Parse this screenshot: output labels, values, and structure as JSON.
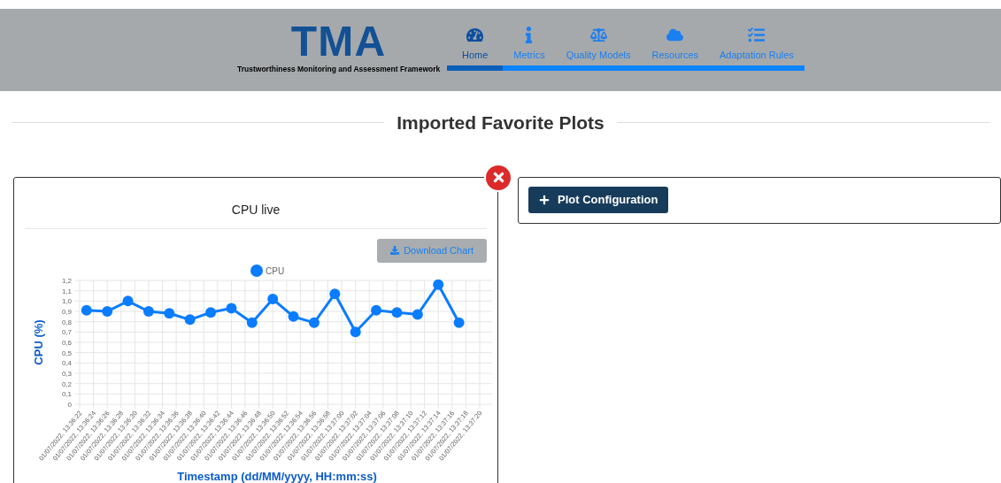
{
  "header": {
    "logo": "TMA",
    "subtitle": "Trustworthiness Monitoring and Assessment Framework"
  },
  "nav": [
    {
      "label": "Home",
      "kind": "gauge",
      "selected": true
    },
    {
      "label": "Metrics",
      "kind": "info",
      "selected": false
    },
    {
      "label": "Quality Models",
      "kind": "scale",
      "selected": false
    },
    {
      "label": "Resources",
      "kind": "cloud",
      "selected": false
    },
    {
      "label": "Adaptation Rules",
      "kind": "tasks",
      "selected": false
    }
  ],
  "page_title": "Imported Favorite Plots",
  "plot_card": {
    "title": "CPU live",
    "download_button": "Download Chart",
    "chart_data": {
      "type": "line",
      "xlabel": "Timestamp (dd/MM/yyyy, HH:mm:ss)",
      "ylabel": "CPU (%)",
      "categories": [
        "01/07/2022, 13:36:22",
        null,
        "01/07/2022, 13:36:24",
        null,
        "01/07/2022, 13:36:26",
        null,
        "01/07/2022, 13:36:28",
        null,
        "01/07/2022, 13:36:30",
        null,
        "01/07/2022, 13:36:32",
        null,
        "01/07/2022, 13:36:34",
        null,
        "01/07/2022, 13:36:36",
        null,
        "01/07/2022, 13:36:38",
        null,
        "01/07/2022, 13:36:40",
        null,
        "01/07/2022, 13:36:42",
        null,
        "01/07/2022, 13:36:44",
        null,
        "01/07/2022, 13:36:46",
        null,
        "01/07/2022, 13:36:48",
        null,
        "01/07/2022, 13:36:50",
        null,
        "01/07/2022, 13:36:52",
        null,
        "01/07/2022, 13:36:54",
        null,
        "01/07/2022, 13:36:56",
        null,
        "01/07/2022, 13:36:58",
        null,
        "01/07/2022, 13:37:00",
        null,
        "01/07/2022, 13:37:02",
        null,
        "01/07/2022, 13:37:04",
        null,
        "01/07/2022, 13:37:06",
        null,
        "01/07/2022, 13:37:08",
        null,
        "01/07/2022, 13:37:10",
        null,
        "01/07/2022, 13:37:12",
        null,
        "01/07/2022, 13:37:14",
        null,
        "01/07/2022, 13:37:16",
        null,
        "01/07/2022, 13:37:18",
        null,
        "01/07/2022, 13:37:20"
      ],
      "grid": true,
      "series": [
        {
          "name": "CPU",
          "color": "#0a7cff",
          "marker": "circle",
          "values": [
            null,
            0.91,
            null,
            null,
            0.9,
            null,
            null,
            1.0,
            null,
            null,
            0.9,
            null,
            null,
            0.88,
            null,
            null,
            0.82,
            null,
            null,
            0.89,
            null,
            null,
            0.93,
            null,
            null,
            0.79,
            null,
            null,
            1.02,
            null,
            null,
            0.85,
            null,
            null,
            0.79,
            null,
            null,
            1.07,
            null,
            null,
            0.7,
            null,
            null,
            0.91,
            null,
            null,
            0.89,
            null,
            null,
            0.87,
            null,
            null,
            1.16,
            null,
            null,
            0.79,
            null,
            null,
            null
          ]
        }
      ],
      "ylim": [
        0,
        1.2
      ],
      "yticks": [
        {
          "value": 0,
          "label": "0"
        },
        {
          "value": 0.1,
          "label": "0,1"
        },
        {
          "value": 0.2,
          "label": "0,2"
        },
        {
          "value": 0.3,
          "label": "0,3"
        },
        {
          "value": 0.4,
          "label": "0,4"
        },
        {
          "value": 0.5,
          "label": "0,5"
        },
        {
          "value": 0.6,
          "label": "0,6"
        },
        {
          "value": 0.7,
          "label": "0,7"
        },
        {
          "value": 0.8,
          "label": "0,8"
        },
        {
          "value": 0.9,
          "label": "0,9"
        },
        {
          "value": 1.0,
          "label": "1,0"
        },
        {
          "value": 1.1,
          "label": "1,1"
        },
        {
          "value": 1.2,
          "label": "1,2"
        }
      ]
    }
  },
  "config_button": "Plot Configuration"
}
